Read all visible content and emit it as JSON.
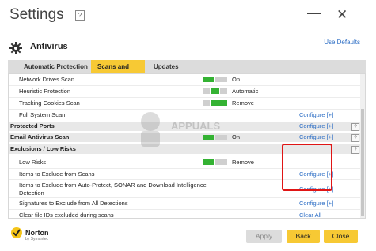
{
  "window": {
    "title": "Settings",
    "help_glyph": "?",
    "minimize_glyph": "—",
    "close_glyph": "✕"
  },
  "product": {
    "name": "Antivirus",
    "use_defaults": "Use Defaults"
  },
  "tabs": [
    {
      "label": "Automatic Protection",
      "active": false
    },
    {
      "label": "Scans and Risks",
      "active": true
    },
    {
      "label": "Updates",
      "active": false
    }
  ],
  "rows": {
    "network_drives": {
      "label": "Network Drives Scan",
      "value": "On"
    },
    "heuristic": {
      "label": "Heuristic Protection",
      "value": "Automatic"
    },
    "tracking_cookies": {
      "label": "Tracking Cookies Scan",
      "value": "Remove"
    },
    "full_system": {
      "label": "Full System Scan",
      "link": "Configure [+]"
    },
    "protected_ports": {
      "label": "Protected Ports",
      "link": "Configure [+]",
      "help": "?"
    },
    "email_scan": {
      "label": "Email Antivirus Scan",
      "value": "On",
      "link": "Configure [+]",
      "help": "?"
    },
    "exclusions": {
      "label": "Exclusions / Low Risks",
      "help": "?"
    },
    "low_risks": {
      "label": "Low Risks",
      "value": "Remove"
    },
    "exclude_scans": {
      "label": "Items to Exclude from Scans",
      "link": "Configure [+]"
    },
    "exclude_autoprotect": {
      "label_line1": "Items to Exclude from Auto-Protect, SONAR and Download Intelligence",
      "label_line2": "Detection",
      "link": "Configure [+]"
    },
    "signatures": {
      "label": "Signatures to Exclude from All Detections",
      "link": "Configure [+]"
    },
    "clear_ids": {
      "label": "Clear file IDs excluded during scans",
      "link": "Clear All"
    }
  },
  "footer": {
    "brand": "Norton",
    "brand_sub": "by Symantec",
    "apply": "Apply",
    "back": "Back",
    "close": "Close"
  },
  "watermark": {
    "text": "APPUALS"
  },
  "colors": {
    "accent_yellow": "#f7c934",
    "toggle_green": "#34b233",
    "link_blue": "#2a6cc4",
    "highlight_red": "#e01515"
  }
}
